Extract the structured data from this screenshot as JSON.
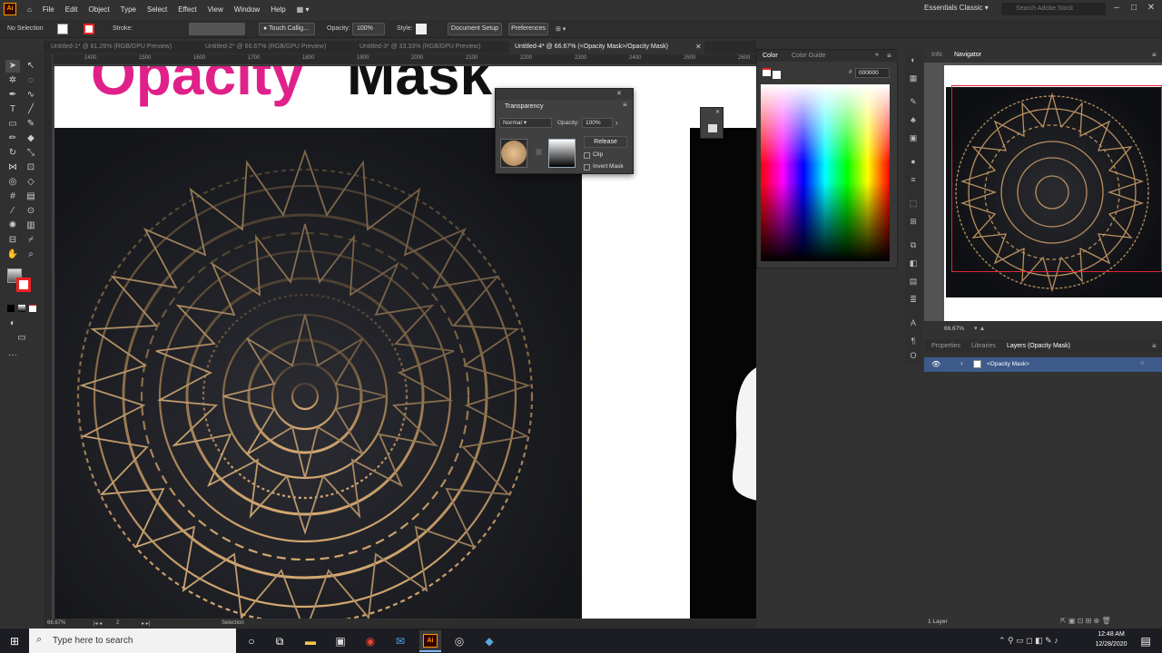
{
  "menu": {
    "items": [
      "File",
      "Edit",
      "Object",
      "Type",
      "Select",
      "Effect",
      "View",
      "Window",
      "Help"
    ],
    "logo": "Ai",
    "workspace": "Essentials Classic",
    "search_placeholder": "Search Adobe Stock"
  },
  "control_bar": {
    "selection": "No Selection",
    "stroke_label": "Stroke:",
    "brush": "Touch Callig...",
    "opacity_label": "Opacity:",
    "opacity_value": "100%",
    "style_label": "Style:",
    "document_setup": "Document Setup",
    "preferences": "Preferences"
  },
  "tabs": [
    "Untitled-1* @ 61.29% (RGB/GPU Preview)",
    "Untitled-2* @ 66.67% (RGB/GPU Preview)",
    "Untitled-3* @ 33.33% (RGB/GPU Preview)",
    "Untitled-4* @ 66.67% (<Opacity Mask>/Opacity Mask)"
  ],
  "ruler": [
    "1400",
    "1500",
    "1600",
    "1700",
    "1800",
    "1900",
    "2000",
    "2100",
    "2200",
    "2300",
    "2400",
    "2500",
    "2600"
  ],
  "canvas": {
    "title_pink": "Opacity",
    "title_black": "Mask"
  },
  "transparency": {
    "title": "Transparency",
    "blend": "Normal",
    "opacity_label": "Opacity:",
    "opacity_value": "100%",
    "release": "Release",
    "clip": "Clip",
    "invert": "Invert Mask"
  },
  "color_panel": {
    "tab_color": "Color",
    "tab_guide": "Color Guide",
    "hex": "000000"
  },
  "navigator": {
    "tab_info": "Info",
    "tab_navigator": "Navigator",
    "zoom": "66.67%"
  },
  "layers": {
    "tab_properties": "Properties",
    "tab_libraries": "Libraries",
    "tab_layers": "Layers (Opacity Mask)",
    "row_name": "<Opacity Mask>",
    "count": "1 Layer"
  },
  "status": {
    "zoom": "66.67%",
    "artboard": "2",
    "mode": "Selection"
  },
  "taskbar": {
    "search_placeholder": "Type here to search",
    "time": "12:48 AM",
    "date": "12/28/2020"
  },
  "colors": {
    "accent_pink": "#e0218a",
    "gold": "#c9a069",
    "selection_blue": "#3d5a8a"
  }
}
